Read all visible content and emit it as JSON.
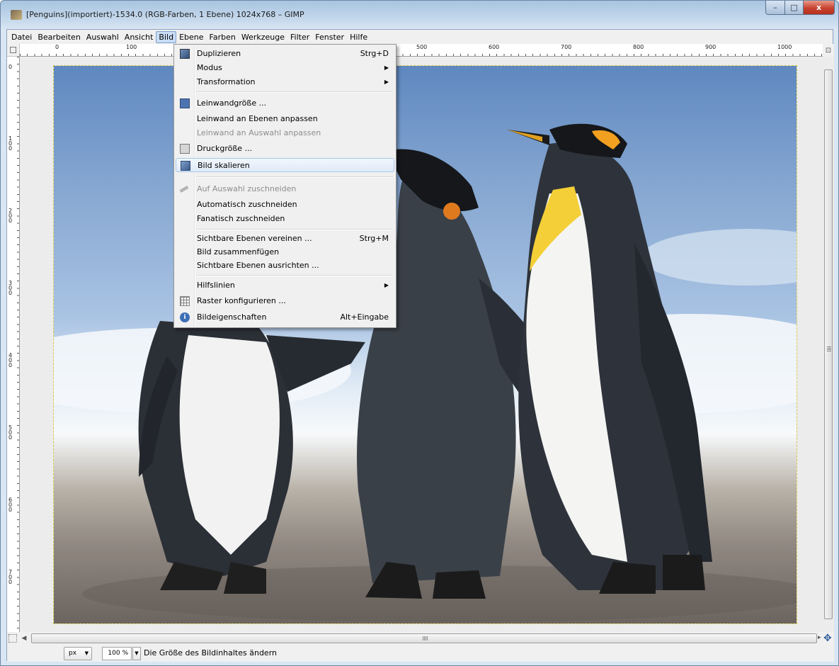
{
  "window": {
    "title": "[Penguins](importiert)-1534.0 (RGB-Farben, 1 Ebene) 1024x768 – GIMP",
    "minimize_glyph": "–",
    "maximize_glyph": "□",
    "close_glyph": "x"
  },
  "menubar": {
    "items": [
      {
        "label": "Datei"
      },
      {
        "label": "Bearbeiten"
      },
      {
        "label": "Auswahl"
      },
      {
        "label": "Ansicht"
      },
      {
        "label": "Bild"
      },
      {
        "label": "Ebene"
      },
      {
        "label": "Farben"
      },
      {
        "label": "Werkzeuge"
      },
      {
        "label": "Filter"
      },
      {
        "label": "Fenster"
      },
      {
        "label": "Hilfe"
      }
    ],
    "active": "Bild"
  },
  "rulers": {
    "top_labels": [
      "0",
      "100",
      "500",
      "600",
      "700",
      "800",
      "900",
      "1000"
    ],
    "left_labels": [
      "0",
      "100",
      "200",
      "300",
      "400",
      "500",
      "600",
      "700"
    ]
  },
  "bild_menu": {
    "items": [
      {
        "label": "Duplizieren",
        "shortcut": "Strg+D",
        "icon": "duplicate-icon",
        "enabled": true
      },
      {
        "label": "Modus",
        "submenu": true,
        "enabled": true
      },
      {
        "label": "Transformation",
        "submenu": true,
        "enabled": true
      },
      {
        "label": "Leinwandgröße ...",
        "icon": "canvas-size-icon",
        "enabled": true
      },
      {
        "label": "Leinwand an Ebenen anpassen",
        "enabled": true
      },
      {
        "label": "Leinwand an Auswahl anpassen",
        "enabled": false
      },
      {
        "label": "Druckgröße ...",
        "icon": "print-size-icon",
        "enabled": true
      },
      {
        "label": "Bild skalieren",
        "icon": "scale-image-icon",
        "enabled": true,
        "highlighted": true
      },
      {
        "label": "Auf Auswahl zuschneiden",
        "icon": "crop-icon",
        "enabled": false
      },
      {
        "label": "Automatisch zuschneiden",
        "enabled": true
      },
      {
        "label": "Fanatisch zuschneiden",
        "enabled": true
      },
      {
        "label": "Sichtbare Ebenen vereinen ...",
        "shortcut": "Strg+M",
        "enabled": true
      },
      {
        "label": "Bild zusammenfügen",
        "enabled": true
      },
      {
        "label": "Sichtbare Ebenen ausrichten ...",
        "enabled": true
      },
      {
        "label": "Hilfslinien",
        "submenu": true,
        "enabled": true
      },
      {
        "label": "Raster konfigurieren ...",
        "icon": "grid-icon",
        "enabled": true
      },
      {
        "label": "Bildeigenschaften",
        "shortcut": "Alt+Eingabe",
        "icon": "info-icon",
        "enabled": true
      }
    ],
    "submenu_glyph": "▶"
  },
  "statusbar": {
    "unit": "px",
    "zoom": "100 %",
    "message": "Die Größe des Bildinhaltes ändern"
  },
  "scroll": {
    "left_arrow": "◀",
    "right_arrow": "▸",
    "navigate_glyph": "✥"
  },
  "colors": {
    "menu_highlight": "#dfeaf8",
    "sky": "#86a7d1",
    "sand": "#8f8780"
  }
}
